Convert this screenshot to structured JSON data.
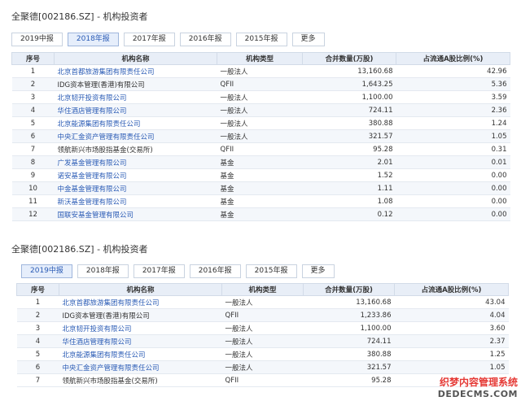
{
  "top": {
    "title": "全聚德[002186.SZ] - 机构投资者",
    "tabs": [
      {
        "label": "2019中报",
        "active": false
      },
      {
        "label": "2018年报",
        "active": true
      },
      {
        "label": "2017年报",
        "active": false
      },
      {
        "label": "2016年报",
        "active": false
      },
      {
        "label": "2015年报",
        "active": false
      },
      {
        "label": "更多",
        "active": false
      }
    ],
    "headers": [
      "序号",
      "机构名称",
      "机构类型",
      "合并数量(万股)",
      "占流通A股比例(%)"
    ],
    "rows": [
      {
        "no": "1",
        "name": "北京首都旅游集团有限责任公司",
        "type": "一般法人",
        "shares": "13,160.68",
        "ratio": "42.96",
        "link": true
      },
      {
        "no": "2",
        "name": "IDG资本管理(香港)有限公司",
        "type": "QFII",
        "shares": "1,643.25",
        "ratio": "5.36",
        "link": false
      },
      {
        "no": "3",
        "name": "北京韧开投资有限公司",
        "type": "一般法人",
        "shares": "1,100.00",
        "ratio": "3.59",
        "link": true
      },
      {
        "no": "4",
        "name": "华住酒店管理有限公司",
        "type": "一般法人",
        "shares": "724.11",
        "ratio": "2.36",
        "link": true
      },
      {
        "no": "5",
        "name": "北京能源集团有限责任公司",
        "type": "一般法人",
        "shares": "380.88",
        "ratio": "1.24",
        "link": true
      },
      {
        "no": "6",
        "name": "中央汇金资产管理有限责任公司",
        "type": "一般法人",
        "shares": "321.57",
        "ratio": "1.05",
        "link": true
      },
      {
        "no": "7",
        "name": "领航新兴市场股指基金(交易所)",
        "type": "QFII",
        "shares": "95.28",
        "ratio": "0.31",
        "link": false
      },
      {
        "no": "8",
        "name": "广发基金管理有限公司",
        "type": "基金",
        "shares": "2.01",
        "ratio": "0.01",
        "link": true
      },
      {
        "no": "9",
        "name": "诺安基金管理有限公司",
        "type": "基金",
        "shares": "1.52",
        "ratio": "0.00",
        "link": true
      },
      {
        "no": "10",
        "name": "中金基金管理有限公司",
        "type": "基金",
        "shares": "1.11",
        "ratio": "0.00",
        "link": true
      },
      {
        "no": "11",
        "name": "新沃基金管理有限公司",
        "type": "基金",
        "shares": "1.08",
        "ratio": "0.00",
        "link": true
      },
      {
        "no": "12",
        "name": "国联安基金管理有限公司",
        "type": "基金",
        "shares": "0.12",
        "ratio": "0.00",
        "link": true
      }
    ]
  },
  "bottom": {
    "title": "全聚德[002186.SZ] - 机构投资者",
    "tabs": [
      {
        "label": "2019中报",
        "active": true
      },
      {
        "label": "2018年报",
        "active": false
      },
      {
        "label": "2017年报",
        "active": false
      },
      {
        "label": "2016年报",
        "active": false
      },
      {
        "label": "2015年报",
        "active": false
      },
      {
        "label": "更多",
        "active": false
      }
    ],
    "headers": [
      "序号",
      "机构名称",
      "机构类型",
      "合并数量(万股)",
      "占流通A股比例(%)"
    ],
    "rows": [
      {
        "no": "1",
        "name": "北京首都旅游集团有限责任公司",
        "type": "一般法人",
        "shares": "13,160.68",
        "ratio": "43.04",
        "link": true
      },
      {
        "no": "2",
        "name": "IDG资本管理(香港)有限公司",
        "type": "QFII",
        "shares": "1,233.86",
        "ratio": "4.04",
        "link": false
      },
      {
        "no": "3",
        "name": "北京韧开投资有限公司",
        "type": "一般法人",
        "shares": "1,100.00",
        "ratio": "3.60",
        "link": true
      },
      {
        "no": "4",
        "name": "华住酒店管理有限公司",
        "type": "一般法人",
        "shares": "724.11",
        "ratio": "2.37",
        "link": true
      },
      {
        "no": "5",
        "name": "北京能源集团有限责任公司",
        "type": "一般法人",
        "shares": "380.88",
        "ratio": "1.25",
        "link": true
      },
      {
        "no": "6",
        "name": "中央汇金资产管理有限责任公司",
        "type": "一般法人",
        "shares": "321.57",
        "ratio": "1.05",
        "link": true
      },
      {
        "no": "7",
        "name": "领航新兴市场股指基金(交易所)",
        "type": "QFII",
        "shares": "95.28",
        "ratio": "",
        "link": false
      }
    ]
  },
  "watermark": {
    "cn": "织梦内容管理系统",
    "en": "DEDECMS.COM"
  }
}
